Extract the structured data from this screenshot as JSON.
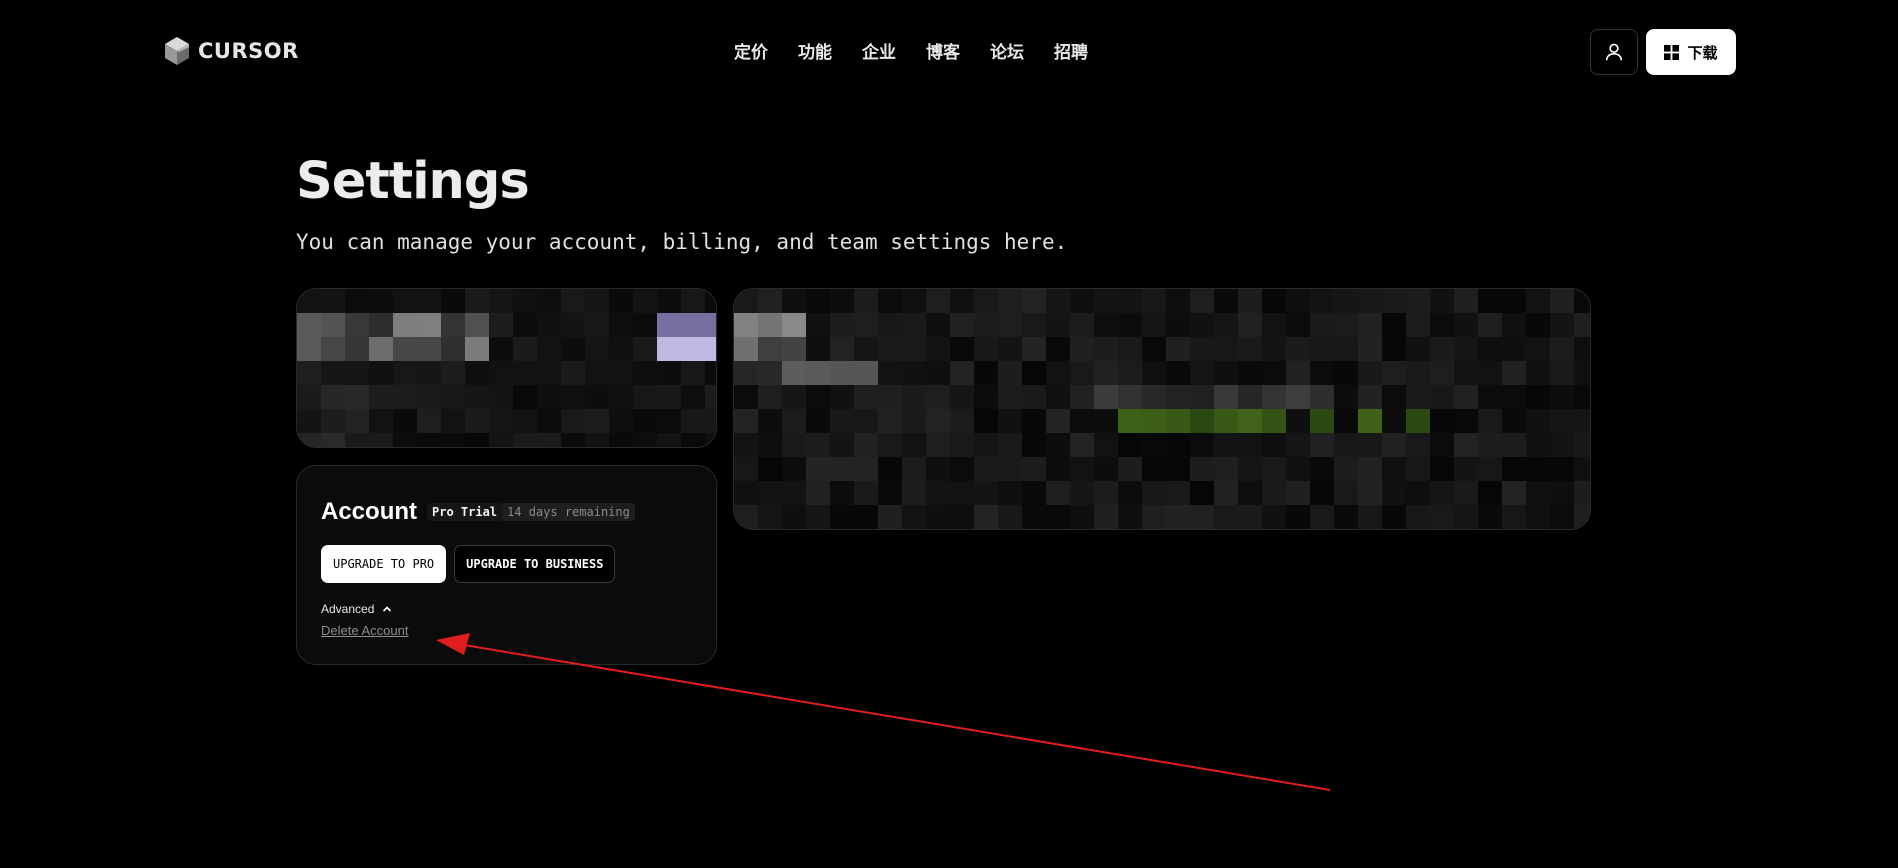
{
  "header": {
    "logo_text": "CURSOR",
    "nav": [
      "定价",
      "功能",
      "企业",
      "博客",
      "论坛",
      "招聘"
    ],
    "download_label": "下载"
  },
  "page": {
    "title": "Settings",
    "subtitle": "You can manage your account, billing, and team settings here."
  },
  "account": {
    "title": "Account",
    "plan_badge": "Pro Trial",
    "days_badge": "14 days remaining",
    "upgrade_pro_label": "UPGRADE TO PRO",
    "upgrade_business_label": "UPGRADE TO BUSINESS",
    "advanced_label": "Advanced",
    "delete_label": "Delete Account"
  },
  "colors": {
    "background": "#000000",
    "card_background": "#0b0b0b",
    "card_border": "#2a2a2a",
    "annotation_arrow": "#e01e1e",
    "usage_highlight": "#3d5f1f"
  },
  "icons": {
    "logo": "cursor-cube-logo-icon",
    "user": "user-icon",
    "download": "windows-icon",
    "advanced_toggle": "chevron-up-icon"
  }
}
